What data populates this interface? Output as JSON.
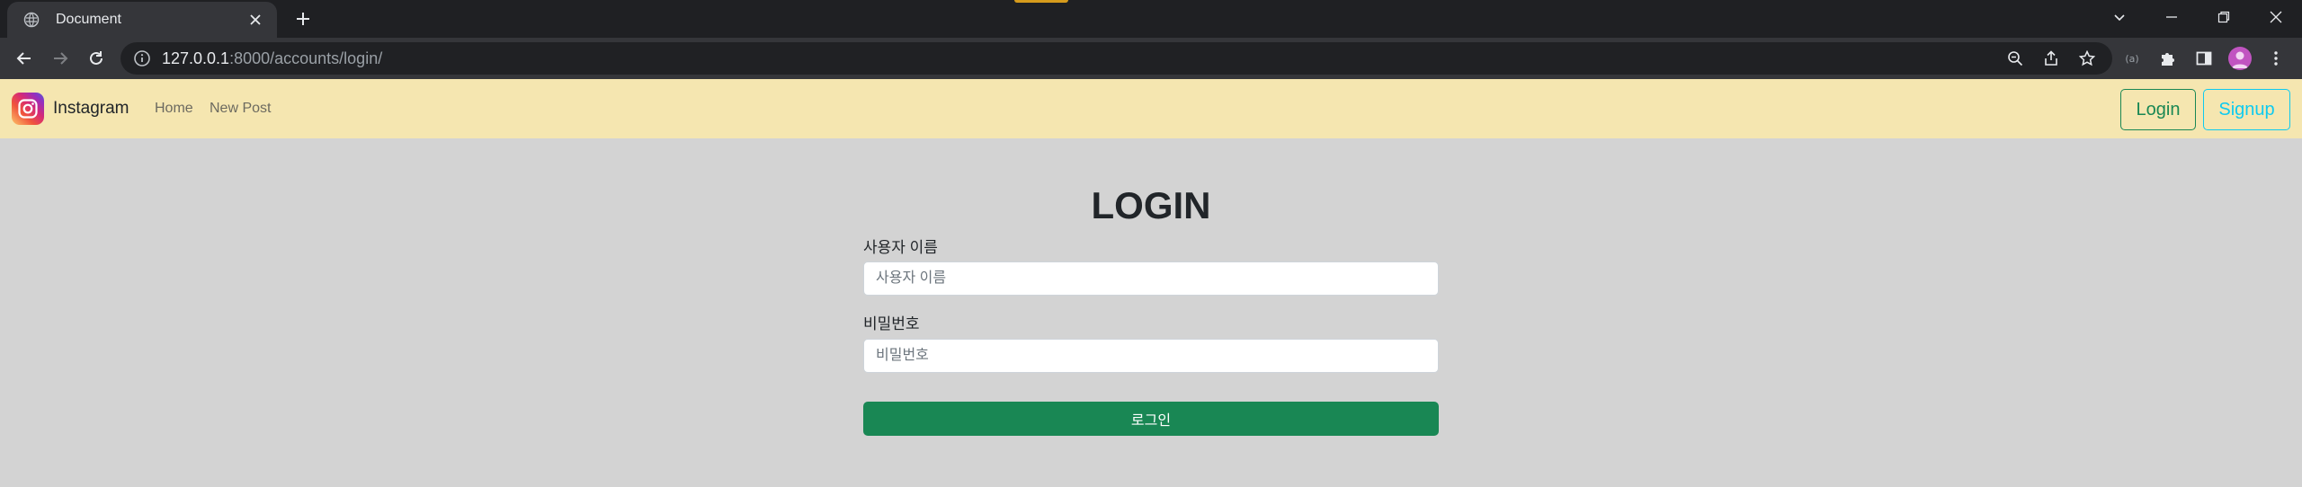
{
  "browser": {
    "tab_title": "Document",
    "url_host": "127.0.0.1",
    "url_rest": ":8000/accounts/login/"
  },
  "navbar": {
    "brand": "Instagram",
    "links": [
      "Home",
      "New Post"
    ],
    "login_button": "Login",
    "signup_button": "Signup"
  },
  "form": {
    "title": "LOGIN",
    "username_label": "사용자 이름",
    "username_placeholder": "사용자 이름",
    "password_label": "비밀번호",
    "password_placeholder": "비밀번호",
    "submit_label": "로그인"
  },
  "colors": {
    "navbar_bg": "#f5e6b0",
    "page_bg": "#d3d3d3",
    "success": "#198754",
    "info": "#0dcaf0"
  }
}
